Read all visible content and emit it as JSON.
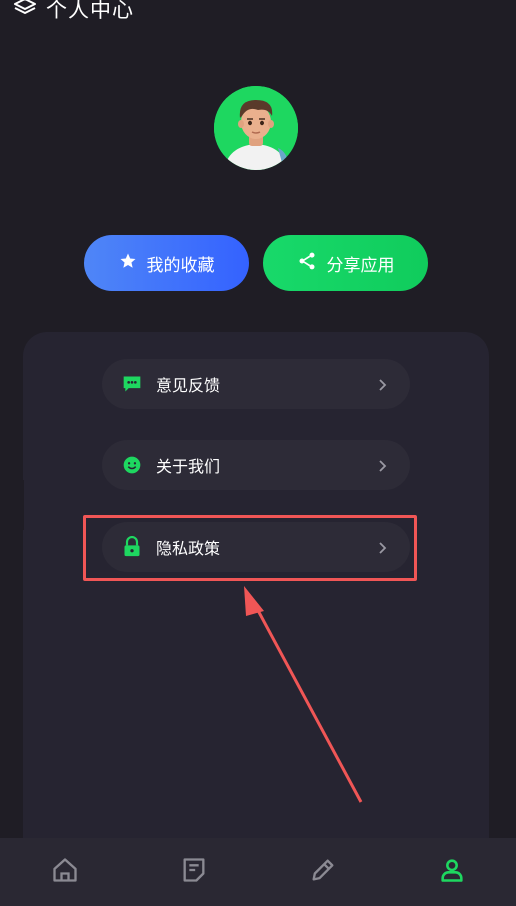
{
  "header": {
    "title": "个人中心",
    "icon": "book-icon"
  },
  "profile": {
    "avatar": "avatar-3d-boy",
    "accent_color": "#1ed760"
  },
  "actions": {
    "favorites_label": "我的收藏",
    "share_label": "分享应用"
  },
  "menu": {
    "items": [
      {
        "label": "意见反馈",
        "icon": "chat-bubble-icon"
      },
      {
        "label": "关于我们",
        "icon": "smiley-icon"
      },
      {
        "label": "隐私政策",
        "icon": "lock-icon"
      }
    ]
  },
  "annotation": {
    "highlight_color": "#f05656"
  },
  "tabbar": {
    "tabs": [
      {
        "icon": "home-icon",
        "active": false
      },
      {
        "icon": "note-icon",
        "active": false
      },
      {
        "icon": "pencil-icon",
        "active": false
      },
      {
        "icon": "user-icon",
        "active": true
      }
    ],
    "active_color": "#1ed760",
    "inactive_color": "#8b8a93"
  }
}
